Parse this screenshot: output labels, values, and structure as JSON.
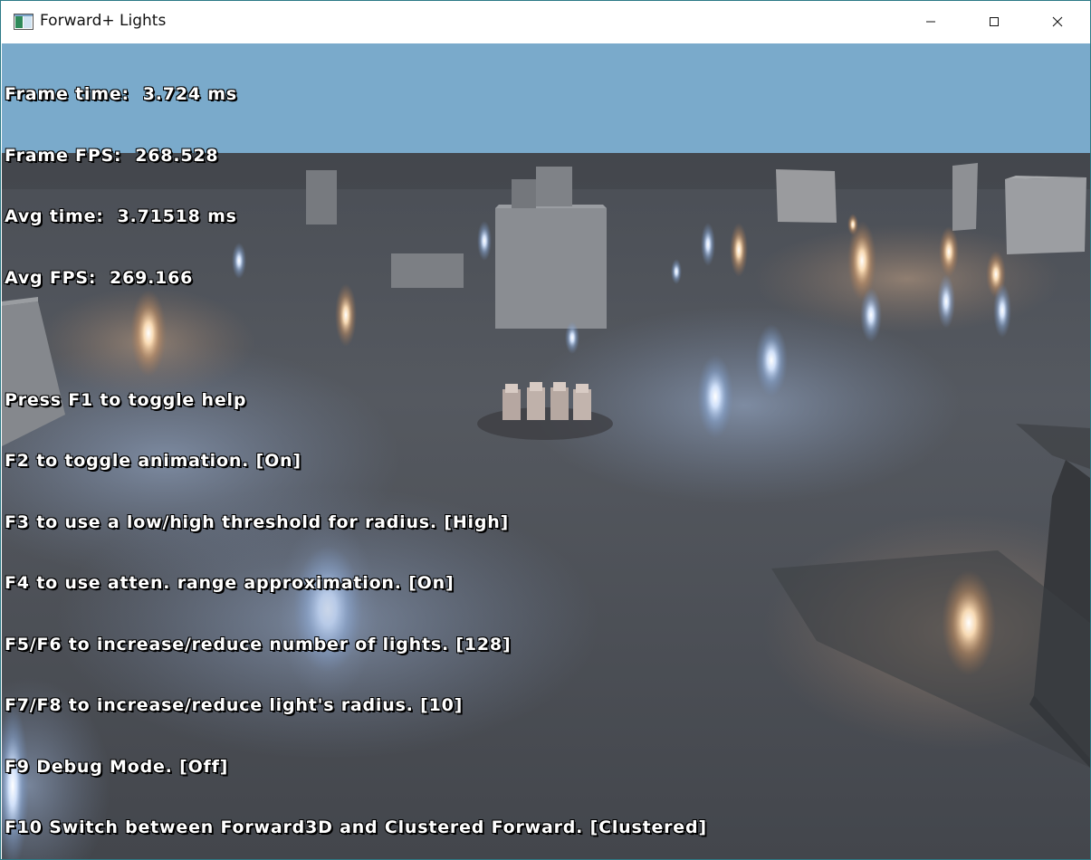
{
  "window": {
    "title": "Forward+ Lights",
    "icons": {
      "app": "app-window-icon",
      "minimize": "minimize-icon",
      "maximize": "maximize-icon",
      "close": "close-icon"
    }
  },
  "hud": {
    "frame_time": "Frame time:  3.724 ms",
    "frame_fps": "Frame FPS:  268.528",
    "avg_time": "Avg time:  3.71518 ms",
    "avg_fps": "Avg FPS:  269.166",
    "help_lines": [
      "Press F1 to toggle help",
      "F2 to toggle animation. [On]",
      "F3 to use a low/high threshold for radius. [High]",
      "F4 to use atten. range approximation. [On]",
      "F5/F6 to increase/reduce number of lights. [128]",
      "F7/F8 to increase/reduce light's radius. [10]",
      "F9 Debug Mode. [Off]",
      "F10 Switch between Forward3D and Clustered Forward. [Clustered]"
    ]
  },
  "colors": {
    "sky": "#7aaacb",
    "floor": "#51555b",
    "warm_light": "#ffcf9a",
    "cool_light": "#b9d6ff",
    "box": "#8e9196"
  }
}
